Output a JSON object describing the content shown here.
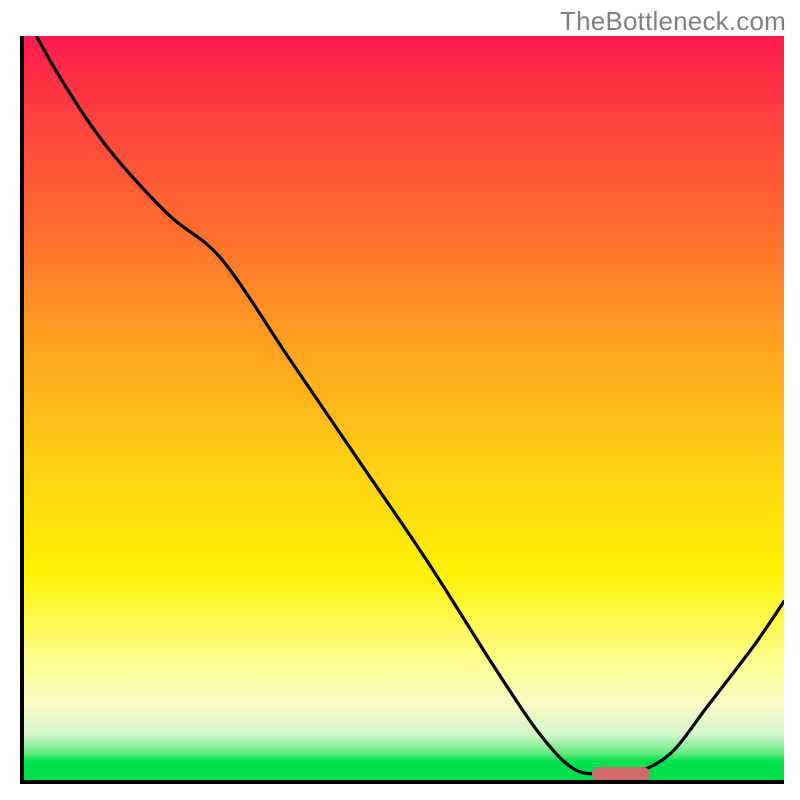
{
  "watermark": "TheBottleneck.com",
  "chart_data": {
    "type": "line",
    "title": "",
    "xlabel": "",
    "ylabel": "",
    "xlim": [
      0,
      100
    ],
    "ylim": [
      0,
      100
    ],
    "series": [
      {
        "name": "curve",
        "x": [
          0,
          5,
          11,
          19,
          26,
          35,
          44,
          53,
          62,
          68,
          72.5,
          77,
          80,
          85,
          90,
          96,
          100
        ],
        "y": [
          103,
          94,
          85,
          76,
          70,
          56.5,
          43,
          29.5,
          15,
          6,
          1.4,
          0.8,
          0.8,
          3.5,
          10,
          18,
          24
        ]
      }
    ],
    "gradient_stops": [
      {
        "pos": 0.0,
        "color": "#ff1a4d"
      },
      {
        "pos": 0.25,
        "color": "#ff6a2f"
      },
      {
        "pos": 0.58,
        "color": "#ffd015"
      },
      {
        "pos": 0.82,
        "color": "#fdfb76"
      },
      {
        "pos": 0.94,
        "color": "#cff5c8"
      },
      {
        "pos": 0.975,
        "color": "#00e04d"
      },
      {
        "pos": 1.0,
        "color": "#00e04d"
      }
    ],
    "marker": {
      "name": "optimal-range",
      "x_center": 78.5,
      "y": 0.8,
      "color": "#d16a6a"
    }
  }
}
